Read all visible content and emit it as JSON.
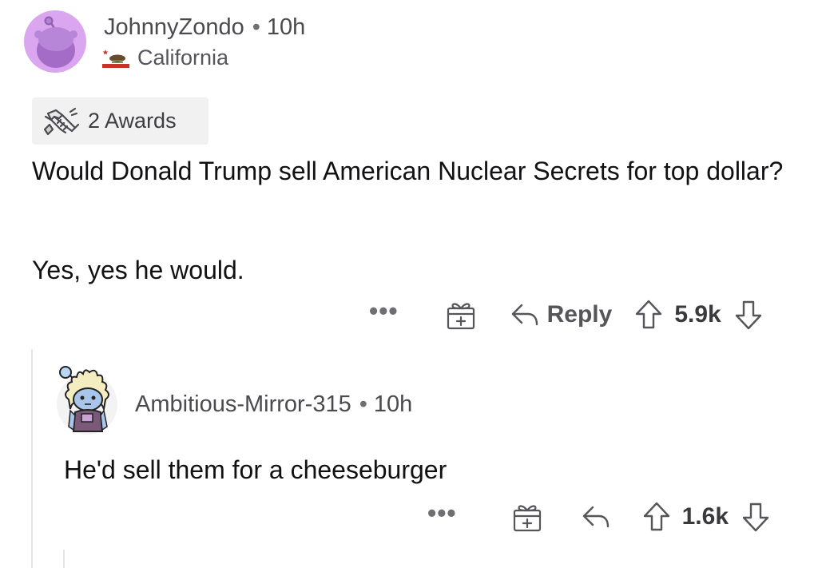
{
  "top_comment": {
    "username": "JohnnyZondo",
    "separator": "•",
    "time": "10h",
    "flair": "California",
    "awards": "2 Awards",
    "body": [
      "Would Donald Trump sell American Nuclear Secrets for top dollar?",
      "Yes, yes he would."
    ],
    "actions": {
      "more": "•••",
      "reply_label": "Reply",
      "score": "5.9k"
    }
  },
  "reply_comment": {
    "username": "Ambitious-Mirror-315",
    "separator": "•",
    "time": "10h",
    "body": "He'd sell them for a cheeseburger",
    "actions": {
      "more": "•••",
      "score": "1.6k"
    }
  },
  "colors": {
    "avatar_purple": "#d9a6ef",
    "avatar_body": "#a56cc7",
    "award_pill": "#f1f1f2",
    "meta_text": "#4a4a4f",
    "body_text": "#111113"
  },
  "icons": {
    "avatar": "snoo-avatar-icon",
    "flair": "california-flag-icon",
    "awards": "handshake-award-icon",
    "gift": "gift-icon",
    "reply": "reply-arrow-icon",
    "upvote": "upvote-arrow-icon",
    "downvote": "downvote-arrow-icon"
  }
}
